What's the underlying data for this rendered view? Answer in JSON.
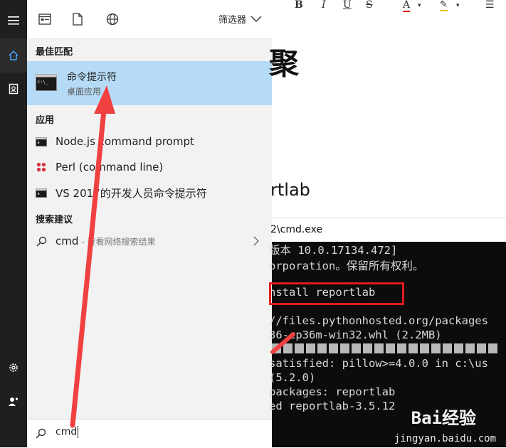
{
  "start_panel": {
    "filter_label": "筛选器",
    "best_match": {
      "heading": "最佳匹配",
      "title": "命令提示符",
      "subtitle": "桌面应用"
    },
    "apps": {
      "heading": "应用",
      "items": [
        {
          "label": "Node.js command prompt",
          "icon": "console-icon"
        },
        {
          "label": "Perl (command line)",
          "icon": "perl-dots-icon"
        },
        {
          "label": "VS 2017的开发人员命令提示符",
          "icon": "console-icon"
        }
      ]
    },
    "suggestions": {
      "heading": "搜索建议",
      "item_label": "cmd",
      "item_hint": "- 查看网络搜索结果"
    },
    "search": {
      "value": "cmd"
    }
  },
  "document": {
    "toolbar": [
      "B",
      "I",
      "U",
      "S",
      "A",
      "☰"
    ],
    "heading": "聚",
    "subheading": "rtlab",
    "cmd_window_title": "2\\cmd.exe",
    "console_lines": [
      "版本 10.0.17134.472]",
      "orporation。保留所有权利。",
      "nstall reportlab",
      "//files.pythonhosted.org/packages",
      "36-cp36m-win32.whl (2.2MB)",
      "satisfied: pillow>=4.0.0 in c:\\us",
      "(5.2.0)",
      " packages: reportlab",
      "ed reportlab-3.5.12"
    ]
  },
  "watermark": {
    "logo": "Bai经验",
    "url": "jingyan.baidu.com"
  },
  "colors": {
    "selection": "#b6dbf6",
    "rail": "#1f1f1f",
    "panel": "#f2f2f2",
    "annotation_red": "#e11b1b"
  }
}
